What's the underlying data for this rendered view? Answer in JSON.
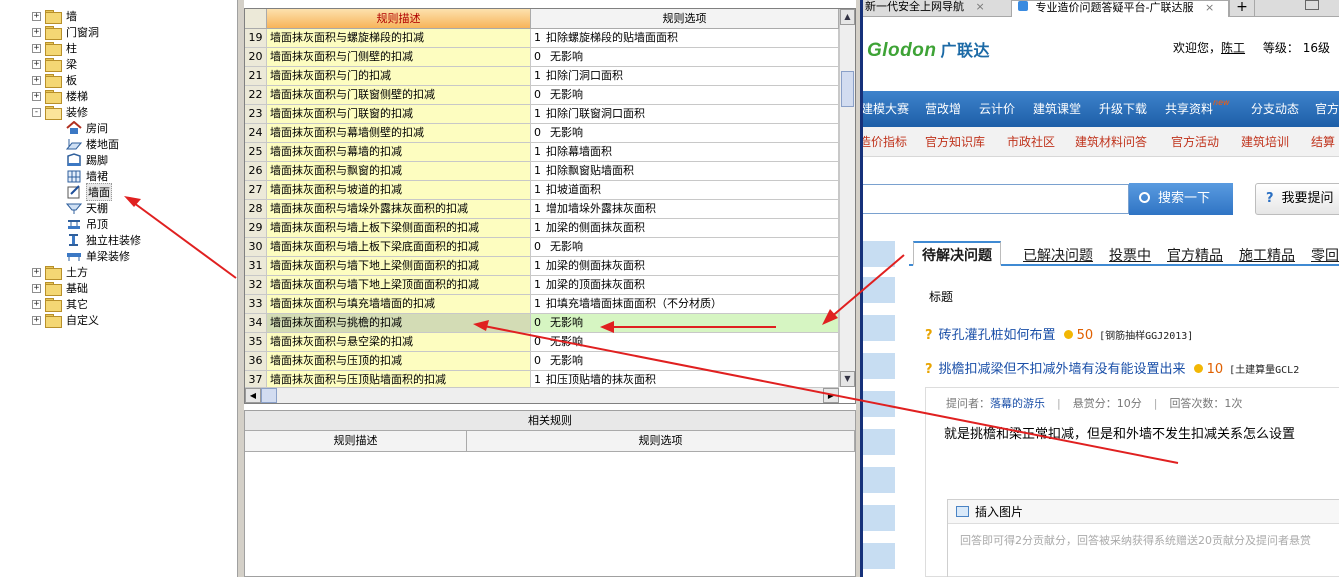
{
  "tree": {
    "items": [
      {
        "label": "墙",
        "expander": "+"
      },
      {
        "label": "门窗洞",
        "expander": "+"
      },
      {
        "label": "柱",
        "expander": "+"
      },
      {
        "label": "梁",
        "expander": "+"
      },
      {
        "label": "板",
        "expander": "+"
      },
      {
        "label": "楼梯",
        "expander": "+"
      },
      {
        "label": "装修",
        "expander": "-"
      },
      {
        "label": "房间"
      },
      {
        "label": "楼地面"
      },
      {
        "label": "踢脚"
      },
      {
        "label": "墙裙"
      },
      {
        "label": "墙面",
        "selected": true
      },
      {
        "label": "天棚"
      },
      {
        "label": "吊顶"
      },
      {
        "label": "独立柱装修"
      },
      {
        "label": "单梁装修"
      },
      {
        "label": "土方",
        "expander": "+"
      },
      {
        "label": "基础",
        "expander": "+"
      },
      {
        "label": "其它",
        "expander": "+"
      },
      {
        "label": "自定义",
        "expander": "+"
      }
    ]
  },
  "grid": {
    "headers": {
      "desc": "规则描述",
      "option": "规则选项"
    },
    "rows": [
      {
        "n": "19",
        "desc": "墙面抹灰面积与螺旋梯段的扣减",
        "code": "1",
        "opt": "扣除螺旋梯段的贴墙面面积"
      },
      {
        "n": "20",
        "desc": "墙面抹灰面积与门侧壁的扣减",
        "code": "0",
        "opt": "无影响"
      },
      {
        "n": "21",
        "desc": "墙面抹灰面积与门的扣减",
        "code": "1",
        "opt": "扣除门洞口面积"
      },
      {
        "n": "22",
        "desc": "墙面抹灰面积与门联窗侧壁的扣减",
        "code": "0",
        "opt": "无影响"
      },
      {
        "n": "23",
        "desc": "墙面抹灰面积与门联窗的扣减",
        "code": "1",
        "opt": "扣除门联窗洞口面积"
      },
      {
        "n": "24",
        "desc": "墙面抹灰面积与幕墙侧壁的扣减",
        "code": "0",
        "opt": "无影响"
      },
      {
        "n": "25",
        "desc": "墙面抹灰面积与幕墙的扣减",
        "code": "1",
        "opt": "扣除幕墙面积"
      },
      {
        "n": "26",
        "desc": "墙面抹灰面积与飘窗的扣减",
        "code": "1",
        "opt": "扣除飘窗贴墙面积"
      },
      {
        "n": "27",
        "desc": "墙面抹灰面积与坡道的扣减",
        "code": "1",
        "opt": "扣坡道面积"
      },
      {
        "n": "28",
        "desc": "墙面抹灰面积与墙垛外露抹灰面积的扣减",
        "code": "1",
        "opt": "增加墙垛外露抹灰面积"
      },
      {
        "n": "29",
        "desc": "墙面抹灰面积与墙上板下梁侧面面积的扣减",
        "code": "1",
        "opt": "加梁的侧面抹灰面积"
      },
      {
        "n": "30",
        "desc": "墙面抹灰面积与墙上板下梁底面面积的扣减",
        "code": "0",
        "opt": "无影响"
      },
      {
        "n": "31",
        "desc": "墙面抹灰面积与墙下地上梁侧面面积的扣减",
        "code": "1",
        "opt": "加梁的侧面抹灰面积"
      },
      {
        "n": "32",
        "desc": "墙面抹灰面积与墙下地上梁顶面面积的扣减",
        "code": "1",
        "opt": "加梁的顶面抹灰面积"
      },
      {
        "n": "33",
        "desc": "墙面抹灰面积与填充墙墙面的扣减",
        "code": "1",
        "opt": "扣填充墙墙面抹面面积（不分材质）"
      },
      {
        "n": "34",
        "desc": "墙面抹灰面积与挑檐的扣减",
        "code": "0",
        "opt": "无影响",
        "highlight": true
      },
      {
        "n": "35",
        "desc": "墙面抹灰面积与悬空梁的扣减",
        "code": "0",
        "opt": "无影响"
      },
      {
        "n": "36",
        "desc": "墙面抹灰面积与压顶的扣减",
        "code": "0",
        "opt": "无影响"
      },
      {
        "n": "37",
        "desc": "墙面抹灰面积与压顶贴墙面积的扣减",
        "code": "1",
        "opt": "扣压顶贴墙的抹灰面积"
      }
    ]
  },
  "related": {
    "title": "相关规则",
    "desc": "规则描述",
    "option": "规则选项"
  },
  "browser": {
    "tabs": [
      {
        "label": "新一代安全上网导航",
        "close": "×"
      },
      {
        "label": "专业造价问题答疑平台-广联达服",
        "close": "×"
      },
      {
        "label": "+"
      }
    ],
    "logo": {
      "en": "Glodon",
      "cn": "广联达"
    },
    "welcome": {
      "prefix": "欢迎您，",
      "user": "陈工",
      "level_label": "等级：",
      "level": "16级"
    },
    "nav1": [
      "建模大赛",
      "营改增",
      "云计价",
      "建筑课堂",
      "升级下载",
      "共享资料",
      "分支动态",
      "官方"
    ],
    "nav1_new": "new",
    "nav2": [
      "造价指标",
      "官方知识库",
      "市政社区",
      "建筑材料问答",
      "官方活动",
      "建筑培训",
      "结算"
    ],
    "search": {
      "button": "搜索一下",
      "ask": "我要提问",
      "ask_icon": "?"
    },
    "qtabs": [
      "待解决问题",
      "已解决问题",
      "投票中",
      "官方精品",
      "施工精品",
      "零回"
    ],
    "title_label": "标题",
    "questions": [
      {
        "title": "砖孔灌孔桩如何布置",
        "points": "50",
        "category": "[钢筋抽样GGJ2013]"
      },
      {
        "title": "挑檐扣减梁但不扣减外墙有没有能设置出来",
        "points": "10",
        "category": "[土建算量GCL2"
      }
    ],
    "detail": {
      "asker_label": "提问者：",
      "asker": "落幕的游乐",
      "reward": "悬赏分：10分",
      "answers": "回答次数：1次",
      "text": "就是挑檐和梁正常扣减，但是和外墙不发生扣减关系怎么设置",
      "insert_image": "插入图片",
      "placeholder": "回答即可得2分贡献分，回答被采纳获得系统赠送20贡献分及提问者悬赏"
    }
  },
  "colors": {
    "arrow": "#e02020",
    "grid_desc_bg": "#fdfdc0",
    "header_accent": "#f7b45a",
    "nav_blue": "#2a6fbe"
  }
}
